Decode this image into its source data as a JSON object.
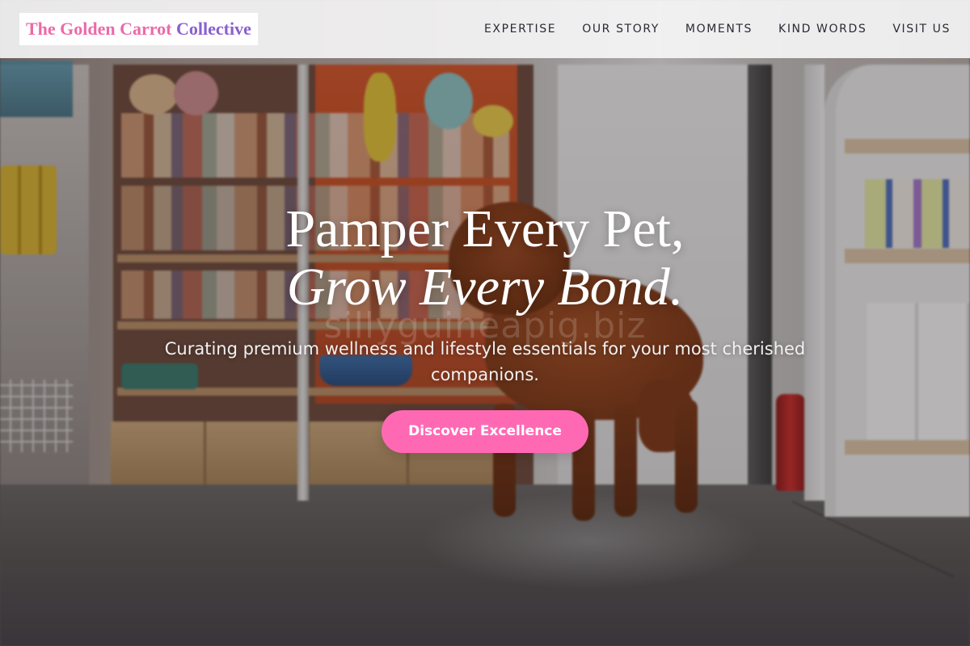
{
  "header": {
    "logo": {
      "part1": "The Golden Carrot",
      "part2": "Collective"
    },
    "nav": [
      {
        "label": "EXPERTISE"
      },
      {
        "label": "OUR STORY"
      },
      {
        "label": "MOMENTS"
      },
      {
        "label": "KIND WORDS"
      },
      {
        "label": "VISIT US"
      }
    ]
  },
  "hero": {
    "title_line1": "Pamper Every Pet,",
    "title_line2": "Grow Every Bond.",
    "subtitle": "Curating premium wellness and lifestyle essentials for your most cherished companions.",
    "cta_label": "Discover Excellence",
    "watermark": "sillyguineapig.biz",
    "background_image": "pet-store-dog-photo"
  },
  "colors": {
    "logo_pink": "#ec6aa8",
    "logo_purple": "#8a5fd0",
    "cta_pink": "#ff69b4",
    "nav_text": "#2a2a33"
  }
}
